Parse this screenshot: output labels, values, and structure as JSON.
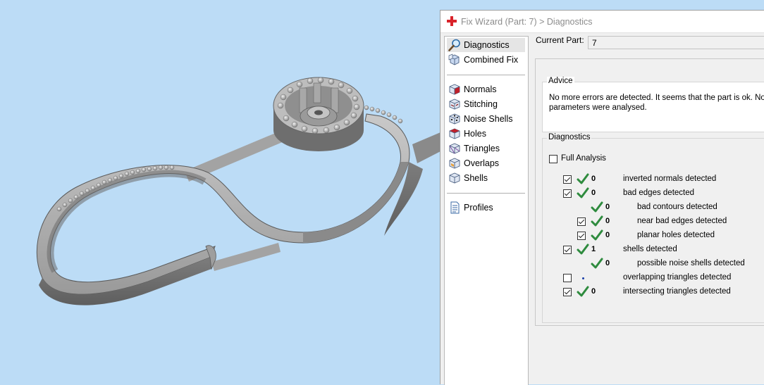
{
  "window": {
    "title": "Fix Wizard (Part: 7) > Diagnostics",
    "current_part_label": "Current Part:",
    "current_part_value": "7"
  },
  "nav": {
    "top": [
      {
        "label": "Diagnostics",
        "icon": "magnifier-icon",
        "selected": true
      },
      {
        "label": "Combined Fix",
        "icon": "combined-fix-icon",
        "selected": false
      }
    ],
    "fixes": [
      {
        "label": "Normals",
        "icon": "normals-cube-icon"
      },
      {
        "label": "Stitching",
        "icon": "stitching-cube-icon"
      },
      {
        "label": "Noise Shells",
        "icon": "noise-shells-icon"
      },
      {
        "label": "Holes",
        "icon": "holes-cube-icon"
      },
      {
        "label": "Triangles",
        "icon": "triangles-cube-icon"
      },
      {
        "label": "Overlaps",
        "icon": "overlaps-cube-icon"
      },
      {
        "label": "Shells",
        "icon": "shells-cube-icon"
      }
    ],
    "bottom": [
      {
        "label": "Profiles",
        "icon": "profiles-document-icon"
      }
    ]
  },
  "advice": {
    "title": "Advice",
    "line1": "No more errors are detected. It seems that the part is ok. No",
    "line2": "parameters were analysed."
  },
  "diagnostics": {
    "title": "Diagnostics",
    "full_analysis_label": "Full Analysis",
    "full_analysis_checked": false,
    "rows": [
      {
        "level": 0,
        "checked": true,
        "has_checkbox": true,
        "status": "ok",
        "count": "0",
        "label": "inverted normals detected"
      },
      {
        "level": 0,
        "checked": true,
        "has_checkbox": true,
        "status": "ok",
        "count": "0",
        "label": "bad edges detected"
      },
      {
        "level": 1,
        "checked": false,
        "has_checkbox": false,
        "status": "ok",
        "count": "0",
        "label": "bad contours detected"
      },
      {
        "level": 1,
        "checked": true,
        "has_checkbox": true,
        "status": "ok",
        "count": "0",
        "label": "near bad edges detected"
      },
      {
        "level": 1,
        "checked": true,
        "has_checkbox": true,
        "status": "ok",
        "count": "0",
        "label": "planar holes detected"
      },
      {
        "level": 0,
        "checked": true,
        "has_checkbox": true,
        "status": "ok",
        "count": "1",
        "label": "shells detected"
      },
      {
        "level": 1,
        "checked": false,
        "has_checkbox": false,
        "status": "ok",
        "count": "0",
        "label": "possible noise shells detected"
      },
      {
        "level": 0,
        "checked": false,
        "has_checkbox": true,
        "status": "not-analysed",
        "count": "",
        "label": "overlapping triangles detected"
      },
      {
        "level": 0,
        "checked": true,
        "has_checkbox": true,
        "status": "ok",
        "count": "0",
        "label": "intersecting triangles detected"
      }
    ]
  },
  "colors": {
    "viewport_background": "#bcdcf6",
    "ok_check": "#2e8b3e",
    "model_gray": "#8e8e8e"
  }
}
